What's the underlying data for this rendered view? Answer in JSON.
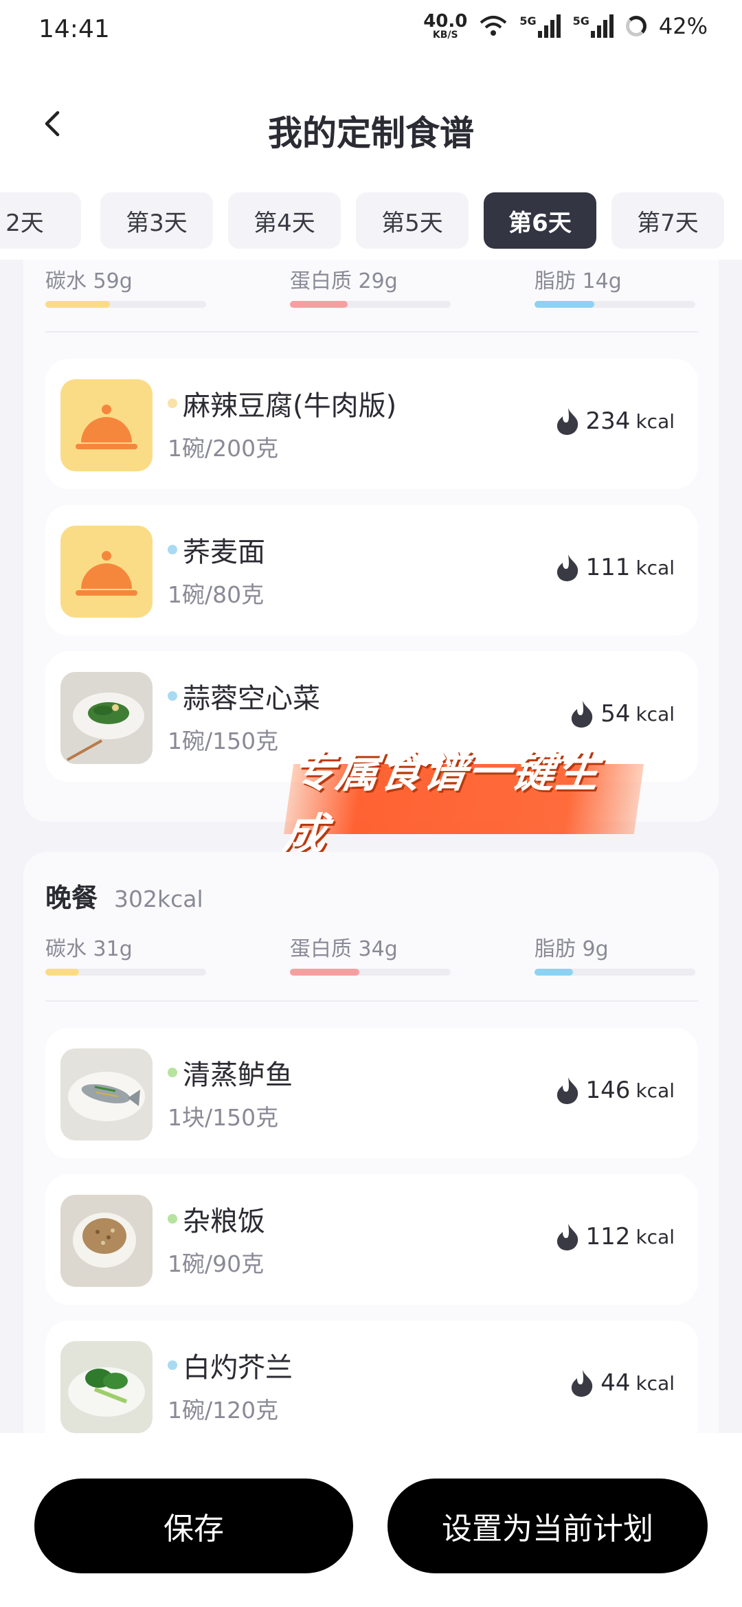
{
  "status_bar": {
    "time": "14:41",
    "net_speed": "40.0",
    "net_unit": "KB/S",
    "sim1": "5G",
    "sim2": "5G",
    "battery": "42%"
  },
  "header": {
    "title": "我的定制食谱"
  },
  "day_tabs": {
    "items": [
      "2天",
      "第3天",
      "第4天",
      "第5天",
      "第6天",
      "第7天"
    ],
    "selected": "第6天"
  },
  "lunch": {
    "macros": [
      {
        "label": "碳水 59g",
        "progress": 0.4,
        "color": "#fbdc86"
      },
      {
        "label": "蛋白质 29g",
        "progress": 0.36,
        "color": "#f5a0a0"
      },
      {
        "label": "脂肪 14g",
        "progress": 0.37,
        "color": "#8ed2f2"
      }
    ],
    "items": [
      {
        "name": "麻辣豆腐(牛肉版)",
        "portion": "1碗/200克",
        "kcal": "234",
        "unit": "kcal",
        "dot_color": "#f8e2a6",
        "image": "cloche-icon"
      },
      {
        "name": "荞麦面",
        "portion": "1碗/80克",
        "kcal": "111",
        "unit": "kcal",
        "dot_color": "#a9daf4",
        "image": "cloche-icon"
      },
      {
        "name": "蒜蓉空心菜",
        "portion": "1碗/150克",
        "kcal": "54",
        "unit": "kcal",
        "dot_color": "#a9daf4",
        "image": "water-spinach-photo"
      }
    ]
  },
  "promo": {
    "text": "专属食谱一键生成"
  },
  "dinner": {
    "title": "晚餐",
    "total": "302kcal",
    "macros": [
      {
        "label": "碳水 31g",
        "progress": 0.21,
        "color": "#fbdc86"
      },
      {
        "label": "蛋白质 34g",
        "progress": 0.43,
        "color": "#f5a0a0"
      },
      {
        "label": "脂肪 9g",
        "progress": 0.24,
        "color": "#8ed2f2"
      }
    ],
    "items": [
      {
        "name": "清蒸鲈鱼",
        "portion": "1块/150克",
        "kcal": "146",
        "unit": "kcal",
        "dot_color": "#b6e3a0",
        "image": "steamed-fish-photo"
      },
      {
        "name": "杂粮饭",
        "portion": "1碗/90克",
        "kcal": "112",
        "unit": "kcal",
        "dot_color": "#b6e3a0",
        "image": "grain-rice-photo"
      },
      {
        "name": "白灼芥兰",
        "portion": "1碗/120克",
        "kcal": "44",
        "unit": "kcal",
        "dot_color": "#a9daf4",
        "image": "kailan-photo"
      }
    ]
  },
  "actions": {
    "save": "保存",
    "set_plan": "设置为当前计划"
  }
}
